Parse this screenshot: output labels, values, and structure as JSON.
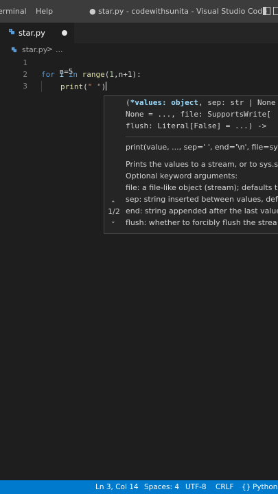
{
  "titlebar": {
    "menu": [
      "erminal",
      "Help"
    ],
    "title": "● star.py - codewithsunita - Visual Studio Code"
  },
  "tab": {
    "label": "star.py"
  },
  "breadcrumb": {
    "file": "star.py",
    "sep": ">",
    "more": "..."
  },
  "editor": {
    "line_numbers": [
      "1",
      "2",
      "3"
    ],
    "line1": {
      "text": "n=5"
    },
    "line2": {
      "kw_for": "for",
      "var_i": " i ",
      "kw_in": "in",
      "fn_range": " range",
      "open": "(",
      "num1": "1",
      "rest": ",n+1):"
    },
    "line3": {
      "fn_print": "print",
      "open": "(",
      "str": "\" \"",
      "close": ")"
    }
  },
  "hover": {
    "sig_line1_open": "(",
    "sig_line1_hl": "*values: object",
    "sig_line1_rest": ", sep: str | None",
    "sig_line2": "None = ..., file: SupportsWrite[",
    "sig_line3": "flush: Literal[False] = ...) ->",
    "usage": "print(value, ..., sep=' ', end='\\n', file=sys.s",
    "doc_lines": [
      "Prints the values to a stream, or to sys.st",
      "Optional keyword arguments:",
      "file: a file-like object (stream); defaults t",
      "sep: string inserted between values, defa",
      "end: string appended after the last value",
      "flush: whether to forcibly flush the strea"
    ],
    "overload": "1/2"
  },
  "statusbar": {
    "position": "Ln 3, Col 14",
    "spaces": "Spaces: 4",
    "encoding": "UTF-8",
    "eol": "CRLF",
    "language": "Python"
  },
  "colors": {
    "status_bar": "#007acc",
    "editor_bg": "#1e1e1e",
    "keyword": "#569cd6",
    "function": "#dcdcaa",
    "string": "#ce9178"
  }
}
